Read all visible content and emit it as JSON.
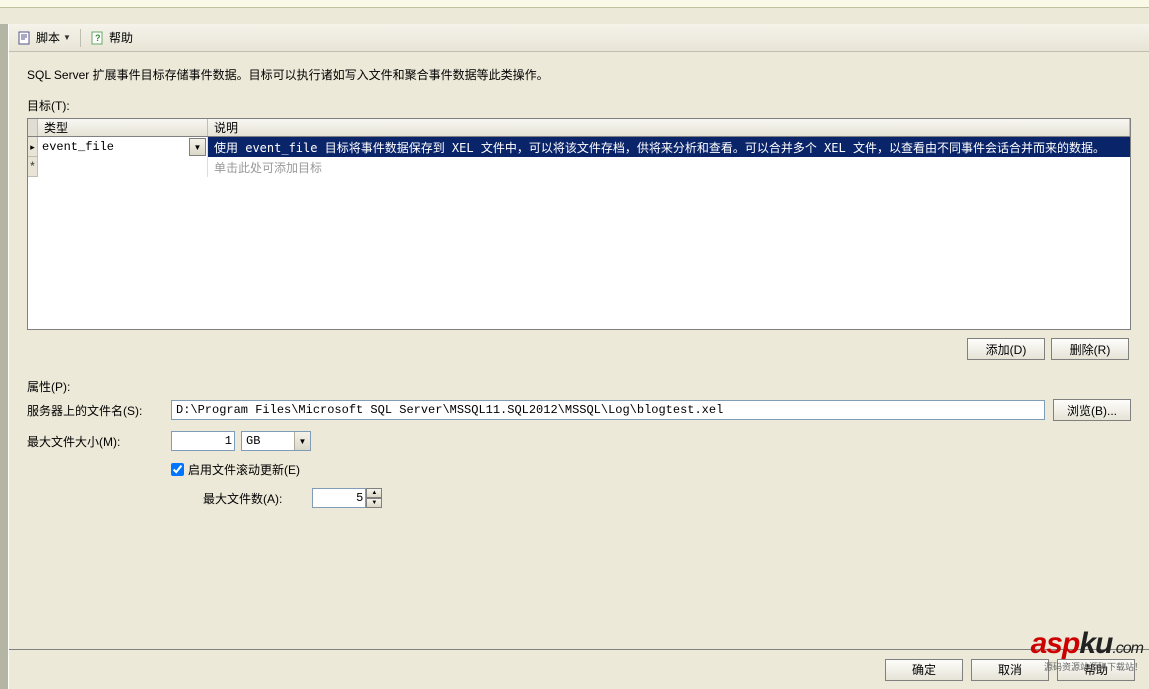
{
  "toolbar": {
    "script_label": "脚本",
    "help_label": "帮助"
  },
  "description": "SQL Server 扩展事件目标存储事件数据。目标可以执行诸如写入文件和聚合事件数据等此类操作。",
  "targets_label": "目标(T):",
  "table": {
    "col_type": "类型",
    "col_desc": "说明",
    "rows": [
      {
        "type": "event_file",
        "desc": "使用 event_file 目标将事件数据保存到 XEL 文件中，可以将该文件存档，供将来分析和查看。可以合并多个 XEL 文件，以查看由不同事件会话合并而来的数据。"
      }
    ],
    "placeholder_text": "单击此处可添加目标"
  },
  "buttons": {
    "add": "添加(D)",
    "remove": "删除(R)",
    "browse": "浏览(B)...",
    "ok": "确定",
    "cancel": "取消",
    "help2": "帮助"
  },
  "props": {
    "section_label": "属性(P):",
    "filename_label": "服务器上的文件名(S):",
    "filename_value": "D:\\Program Files\\Microsoft SQL Server\\MSSQL11.SQL2012\\MSSQL\\Log\\blogtest.xel",
    "maxsize_label": "最大文件大小(M):",
    "maxsize_value": "1",
    "maxsize_unit": "GB",
    "rollover_label": "启用文件滚动更新(E)",
    "maxfiles_label": "最大文件数(A):",
    "maxfiles_value": "5"
  },
  "watermark": {
    "a": "asp",
    "b": "ku",
    "suffix": ".com",
    "tagline": "源码资源站源码下载站！"
  }
}
